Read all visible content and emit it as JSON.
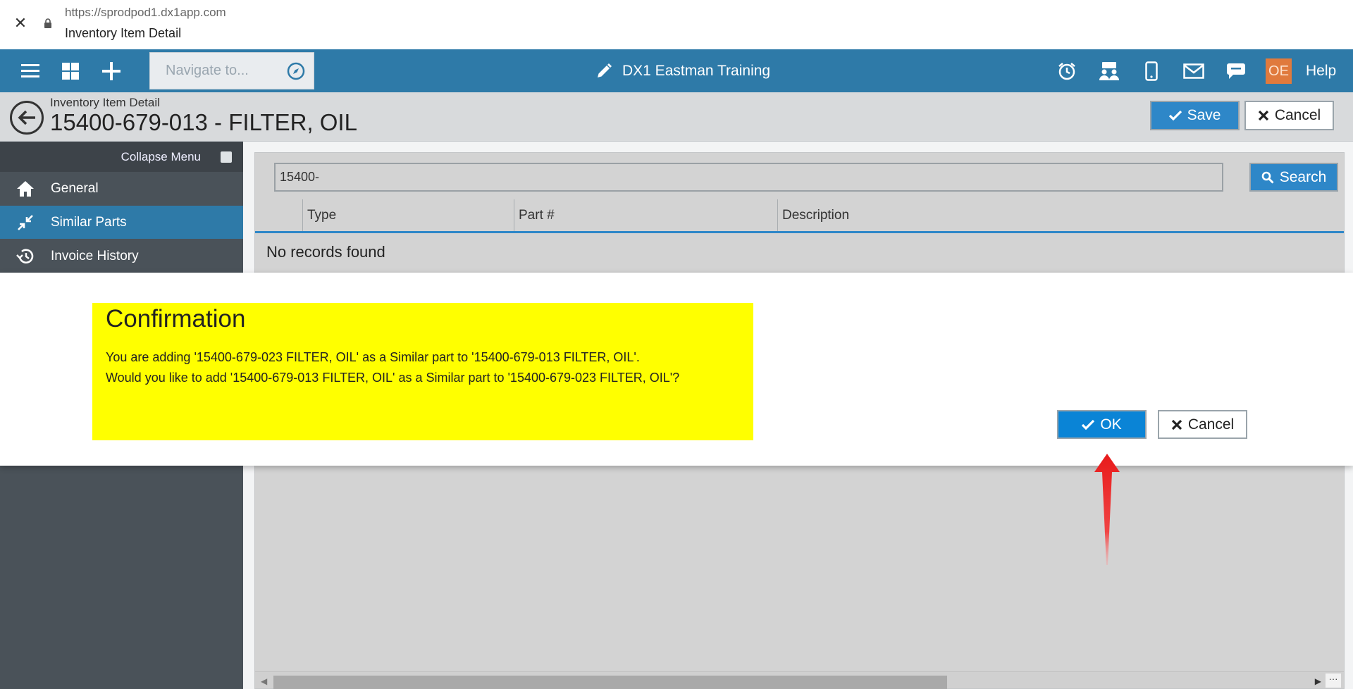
{
  "browser": {
    "url": "https://sprodpod1.dx1app.com",
    "tab_title": "Inventory Item Detail"
  },
  "topbar": {
    "navigate_placeholder": "Navigate to...",
    "environment": "DX1 Eastman Training",
    "user_initials": "OE",
    "help_label": "Help",
    "icons": [
      "menu-icon",
      "dashboard-grid-icon",
      "plus-icon",
      "compass-icon",
      "pencil-icon",
      "alarm-clock-icon",
      "users-icon",
      "mobile-phone-icon",
      "mail-icon",
      "chat-icon"
    ]
  },
  "header": {
    "subtitle": "Inventory Item Detail",
    "title": "15400-679-013 - FILTER, OIL",
    "save_label": "Save",
    "cancel_label": "Cancel"
  },
  "sidebar": {
    "collapse_label": "Collapse Menu",
    "items": [
      {
        "label": "General",
        "icon": "home-icon",
        "active": false
      },
      {
        "label": "Similar Parts",
        "icon": "compress-arrows-icon",
        "active": true
      },
      {
        "label": "Invoice History",
        "icon": "history-icon",
        "active": false
      }
    ]
  },
  "main": {
    "search_value": "15400-",
    "search_label": "Search",
    "columns": [
      "",
      "Type",
      "Part #",
      "Description"
    ],
    "empty_message": "No records found"
  },
  "dialog": {
    "title": "Confirmation",
    "line1": "You are adding '15400-679-023 FILTER, OIL' as a Similar part to '15400-679-013 FILTER, OIL'.",
    "line2": "Would you like to add '15400-679-013 FILTER, OIL' as a Similar part to '15400-679-023 FILTER, OIL'?",
    "ok_label": "OK",
    "cancel_label": "Cancel"
  },
  "colors": {
    "primary": "#2e7aa8",
    "button_blue": "#2e87c8",
    "sidebar": "#4a5259",
    "highlight": "#ffff00",
    "annotation_arrow": "#e81b1b"
  }
}
